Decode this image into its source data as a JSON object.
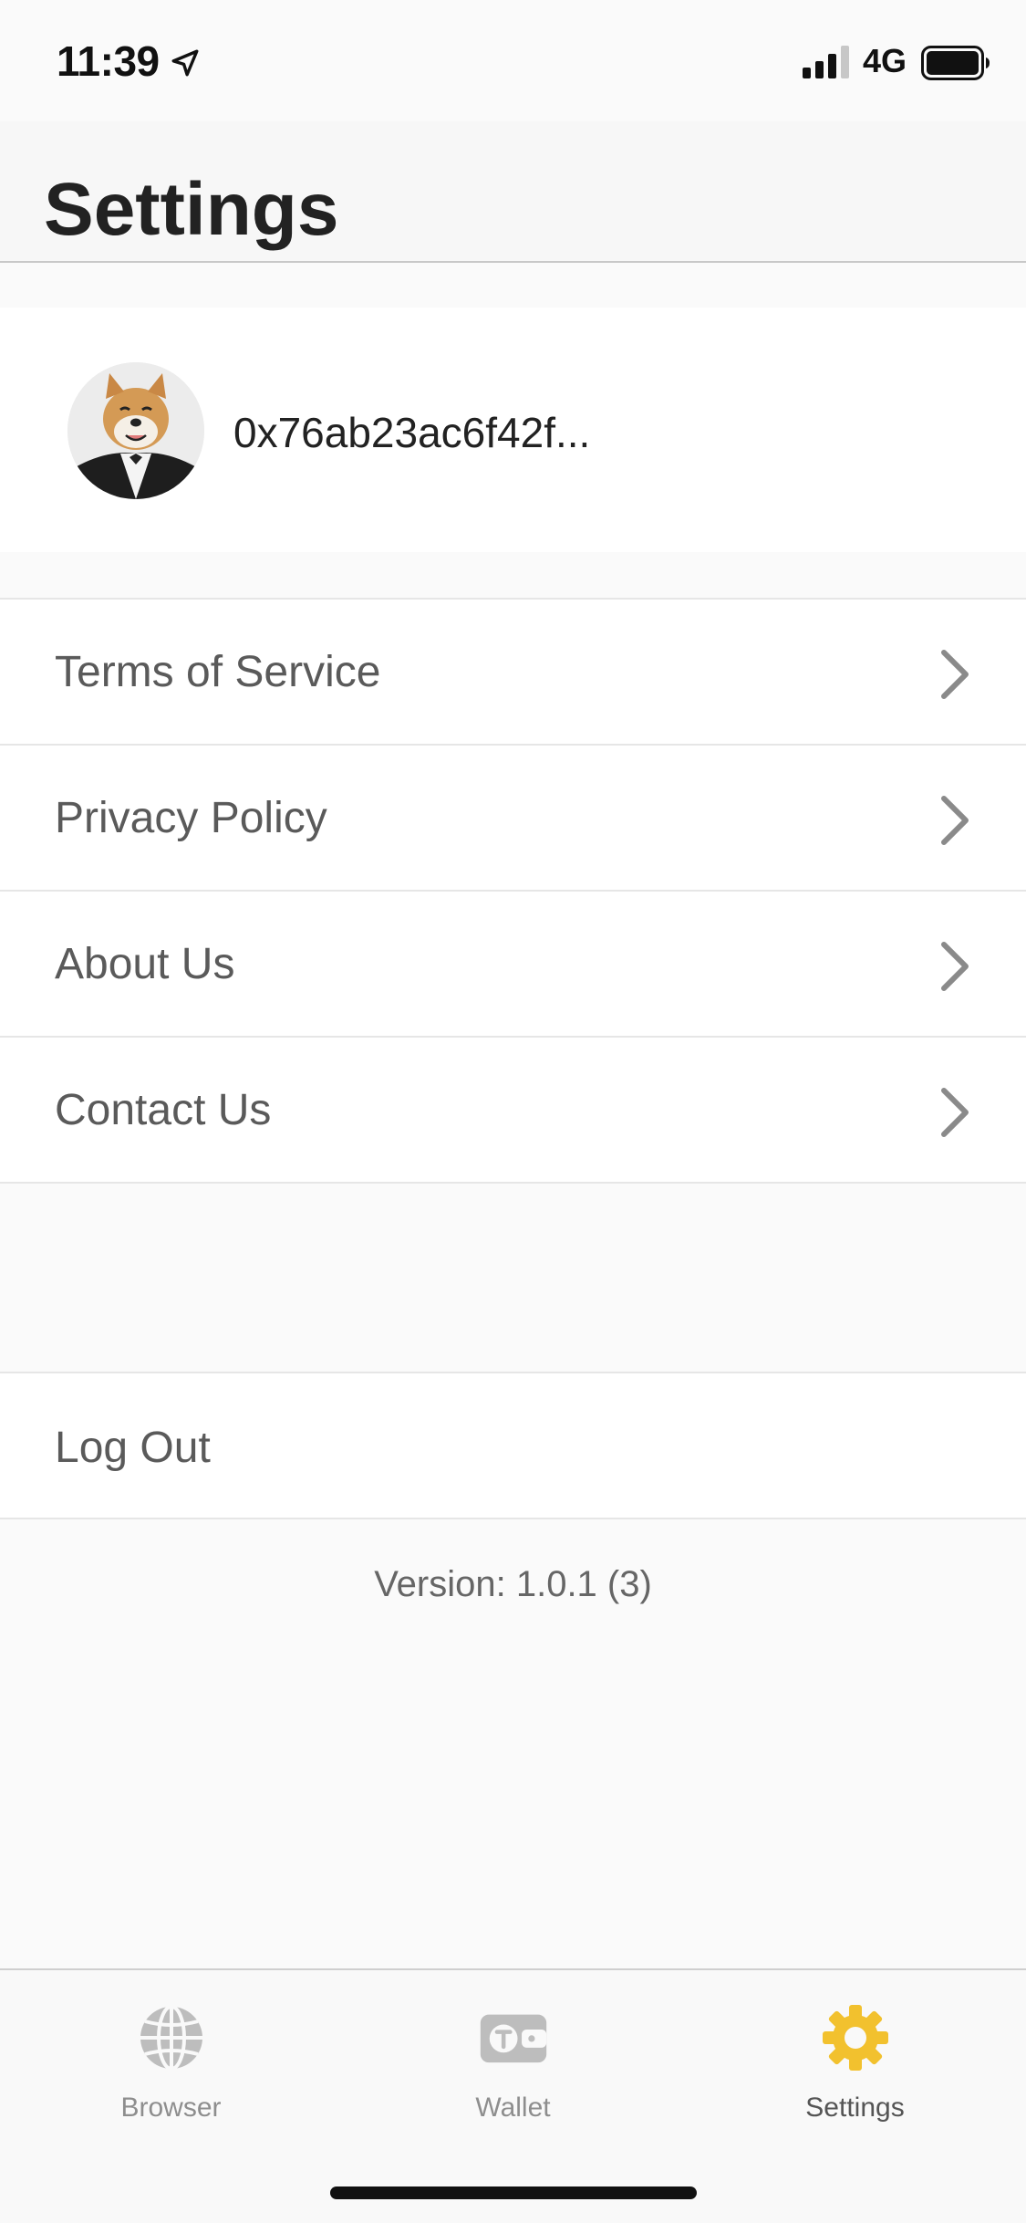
{
  "status_bar": {
    "time": "11:39",
    "network": "4G"
  },
  "header": {
    "title": "Settings"
  },
  "profile": {
    "address": "0x76ab23ac6f42f..."
  },
  "menu": {
    "items": [
      {
        "label": "Terms of Service"
      },
      {
        "label": "Privacy Policy"
      },
      {
        "label": "About Us"
      },
      {
        "label": "Contact Us"
      }
    ]
  },
  "logout": {
    "label": "Log Out"
  },
  "version": "Version: 1.0.1 (3)",
  "tab_bar": {
    "tabs": [
      {
        "label": "Browser",
        "icon": "globe-icon",
        "active": false
      },
      {
        "label": "Wallet",
        "icon": "wallet-icon",
        "active": false
      },
      {
        "label": "Settings",
        "icon": "gear-icon",
        "active": true
      }
    ]
  },
  "colors": {
    "accent": "#f2c12e",
    "inactive_icon": "#b8b8b8",
    "background": "#fafafa"
  }
}
